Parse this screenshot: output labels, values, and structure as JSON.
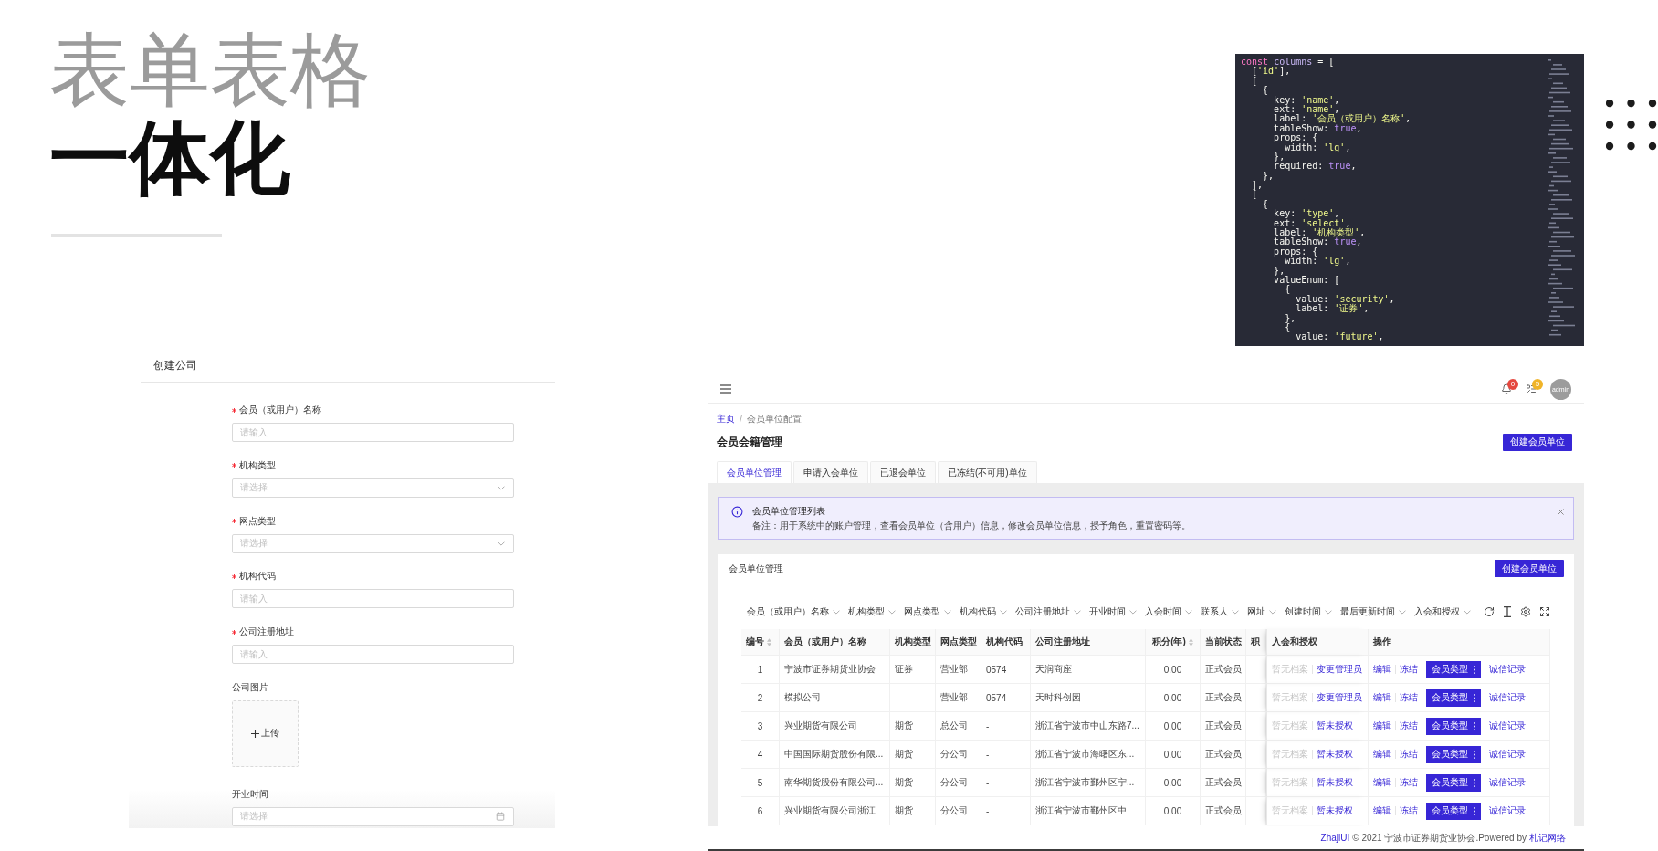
{
  "slide": {
    "headline": "表单表格",
    "headline_bold": "一体化"
  },
  "code_editor": {
    "lines": [
      [
        {
          "kind": "keyword",
          "text": "const"
        },
        {
          "kind": "name",
          "text": " columns"
        },
        {
          "kind": "plain",
          "text": " = ["
        }
      ],
      [
        {
          "kind": "plain",
          "text": "  ["
        },
        {
          "kind": "string",
          "text": "'id'"
        },
        {
          "kind": "plain",
          "text": "],"
        }
      ],
      [
        {
          "kind": "plain",
          "text": "  ["
        }
      ],
      [
        {
          "kind": "plain",
          "text": "    {"
        }
      ],
      [
        {
          "kind": "plain",
          "text": "      key: "
        },
        {
          "kind": "string",
          "text": "'name'"
        },
        {
          "kind": "plain",
          "text": ","
        }
      ],
      [
        {
          "kind": "plain",
          "text": "      ext: "
        },
        {
          "kind": "string",
          "text": "'name'"
        },
        {
          "kind": "plain",
          "text": ","
        }
      ],
      [
        {
          "kind": "plain",
          "text": "      label: "
        },
        {
          "kind": "string",
          "text": "'会员（或用户）名称'"
        },
        {
          "kind": "plain",
          "text": ","
        }
      ],
      [
        {
          "kind": "plain",
          "text": "      tableShow: "
        },
        {
          "kind": "literal",
          "text": "true"
        },
        {
          "kind": "plain",
          "text": ","
        }
      ],
      [
        {
          "kind": "plain",
          "text": "      props: {"
        }
      ],
      [
        {
          "kind": "plain",
          "text": "        width: "
        },
        {
          "kind": "string",
          "text": "'lg'"
        },
        {
          "kind": "plain",
          "text": ","
        }
      ],
      [
        {
          "kind": "plain",
          "text": "      },"
        }
      ],
      [
        {
          "kind": "plain",
          "text": "      required: "
        },
        {
          "kind": "literal",
          "text": "true"
        },
        {
          "kind": "plain",
          "text": ","
        }
      ],
      [
        {
          "kind": "plain",
          "text": "    },"
        }
      ],
      [
        {
          "kind": "plain",
          "text": "  ],"
        }
      ],
      [
        {
          "kind": "plain",
          "text": "  ["
        }
      ],
      [
        {
          "kind": "plain",
          "text": "    {"
        }
      ],
      [
        {
          "kind": "plain",
          "text": "      key: "
        },
        {
          "kind": "string",
          "text": "'type'"
        },
        {
          "kind": "plain",
          "text": ","
        }
      ],
      [
        {
          "kind": "plain",
          "text": "      ext: "
        },
        {
          "kind": "string",
          "text": "'select'"
        },
        {
          "kind": "plain",
          "text": ","
        }
      ],
      [
        {
          "kind": "plain",
          "text": "      label: "
        },
        {
          "kind": "string",
          "text": "'机构类型'"
        },
        {
          "kind": "plain",
          "text": ","
        }
      ],
      [
        {
          "kind": "plain",
          "text": "      tableShow: "
        },
        {
          "kind": "literal",
          "text": "true"
        },
        {
          "kind": "plain",
          "text": ","
        }
      ],
      [
        {
          "kind": "plain",
          "text": "      props: {"
        }
      ],
      [
        {
          "kind": "plain",
          "text": "        width: "
        },
        {
          "kind": "string",
          "text": "'lg'"
        },
        {
          "kind": "plain",
          "text": ","
        }
      ],
      [
        {
          "kind": "plain",
          "text": "      },"
        }
      ],
      [
        {
          "kind": "plain",
          "text": "      valueEnum: ["
        }
      ],
      [
        {
          "kind": "plain",
          "text": "        {"
        }
      ],
      [
        {
          "kind": "plain",
          "text": "          value: "
        },
        {
          "kind": "string",
          "text": "'security'"
        },
        {
          "kind": "plain",
          "text": ","
        }
      ],
      [
        {
          "kind": "plain",
          "text": "          label: "
        },
        {
          "kind": "string",
          "text": "'证券'"
        },
        {
          "kind": "plain",
          "text": ","
        }
      ],
      [
        {
          "kind": "plain",
          "text": "        },"
        }
      ],
      [
        {
          "kind": "plain",
          "text": "        {"
        }
      ],
      [
        {
          "kind": "plain",
          "text": "          value: "
        },
        {
          "kind": "string",
          "text": "'future'"
        },
        {
          "kind": "plain",
          "text": ","
        }
      ]
    ]
  },
  "form_panel": {
    "title": "创建公司",
    "fields": [
      {
        "kind": "input",
        "label": "会员（或用户）名称",
        "required": true,
        "placeholder": "请输入"
      },
      {
        "kind": "select",
        "label": "机构类型",
        "required": true,
        "placeholder": "请选择"
      },
      {
        "kind": "select",
        "label": "网点类型",
        "required": true,
        "placeholder": "请选择"
      },
      {
        "kind": "input",
        "label": "机构代码",
        "required": true,
        "placeholder": "请输入"
      },
      {
        "kind": "input",
        "label": "公司注册地址",
        "required": true,
        "placeholder": "请输入"
      },
      {
        "kind": "upload",
        "label": "公司图片",
        "required": false,
        "button_text": "上传"
      },
      {
        "kind": "date",
        "label": "开业时间",
        "required": false,
        "placeholder": "请选择"
      }
    ]
  },
  "app": {
    "top_bar": {
      "badges": [
        {
          "kind": "bell",
          "count": "0",
          "color": "#e5483f"
        },
        {
          "kind": "list",
          "count": "5",
          "color": "#f0b429"
        }
      ],
      "avatar": "admin"
    },
    "breadcrumb": {
      "items": [
        {
          "label": "主页",
          "current": false
        },
        {
          "label": "会员单位配置",
          "current": true
        }
      ],
      "separator": "/"
    },
    "page_title": "会员会籍管理",
    "page_button": "创建会员单位",
    "tabs": [
      {
        "label": "会员单位管理",
        "selected": true
      },
      {
        "label": "申请入会单位",
        "selected": false
      },
      {
        "label": "已退会单位",
        "selected": false
      },
      {
        "label": "已冻结(不可用)单位",
        "selected": false
      }
    ],
    "alert": {
      "title": "会员单位管理列表",
      "description": "备注：用于系统中的账户管理，查看会员单位（含用户）信息，修改会员单位信息，授予角色，重置密码等。"
    },
    "card": {
      "title": "会员单位管理",
      "button": "创建会员单位",
      "column_filters": [
        "会员（或用户）名称",
        "机构类型",
        "网点类型",
        "机构代码",
        "公司注册地址",
        "开业时间",
        "入会时间",
        "联系人",
        "网址",
        "创建时间",
        "最后更新时间",
        "入会和授权"
      ],
      "table": {
        "columns": [
          {
            "label": "编号",
            "kind": "index",
            "sortable": true
          },
          {
            "label": "会员（或用户）名称",
            "kind": "text",
            "sortable": false
          },
          {
            "label": "机构类型",
            "kind": "text",
            "sortable": false
          },
          {
            "label": "网点类型",
            "kind": "text",
            "sortable": false
          },
          {
            "label": "机构代码",
            "kind": "text",
            "sortable": false
          },
          {
            "label": "公司注册地址",
            "kind": "text",
            "sortable": false
          },
          {
            "label": "积分(年)",
            "kind": "number",
            "sortable": true
          },
          {
            "label": "当前状态",
            "kind": "text",
            "sortable": false
          },
          {
            "label": "积",
            "kind": "clipped",
            "sortable": false
          },
          {
            "label": "入会和授权",
            "kind": "membership",
            "sortable": false
          },
          {
            "label": "操作",
            "kind": "actions",
            "sortable": false
          }
        ],
        "rows": [
          {
            "cells": [
              "1",
              "宁波市证券期货业协会",
              "证券",
              "营业部",
              "0574",
              "天润商座",
              "0.00",
              "正式会员"
            ],
            "membership": [
              {
                "label": "暂无档案",
                "disabled": true
              },
              {
                "label": "变更管理员",
                "disabled": false
              }
            ],
            "actions": [
              {
                "kind": "link",
                "label": "编辑"
              },
              {
                "kind": "link",
                "label": "冻结"
              },
              {
                "kind": "menu_button",
                "label": "会员类型"
              },
              {
                "kind": "link",
                "label": "诚信记录"
              }
            ]
          },
          {
            "cells": [
              "2",
              "模拟公司",
              "-",
              "营业部",
              "0574",
              "天时科创园",
              "0.00",
              "正式会员"
            ],
            "membership": [
              {
                "label": "暂无档案",
                "disabled": true
              },
              {
                "label": "变更管理员",
                "disabled": false
              }
            ],
            "actions": [
              {
                "kind": "link",
                "label": "编辑"
              },
              {
                "kind": "link",
                "label": "冻结"
              },
              {
                "kind": "menu_button",
                "label": "会员类型"
              },
              {
                "kind": "link",
                "label": "诚信记录"
              }
            ]
          },
          {
            "cells": [
              "3",
              "兴业期货有限公司",
              "期货",
              "总公司",
              "-",
              "浙江省宁波市中山东路7...",
              "0.00",
              "正式会员"
            ],
            "membership": [
              {
                "label": "暂无档案",
                "disabled": true
              },
              {
                "label": "暂未授权",
                "disabled": false
              }
            ],
            "actions": [
              {
                "kind": "link",
                "label": "编辑"
              },
              {
                "kind": "link",
                "label": "冻结"
              },
              {
                "kind": "menu_button",
                "label": "会员类型"
              },
              {
                "kind": "link",
                "label": "诚信记录"
              }
            ]
          },
          {
            "cells": [
              "4",
              "中国国际期货股份有限...",
              "期货",
              "分公司",
              "-",
              "浙江省宁波市海曙区东...",
              "0.00",
              "正式会员"
            ],
            "membership": [
              {
                "label": "暂无档案",
                "disabled": true
              },
              {
                "label": "暂未授权",
                "disabled": false
              }
            ],
            "actions": [
              {
                "kind": "link",
                "label": "编辑"
              },
              {
                "kind": "link",
                "label": "冻结"
              },
              {
                "kind": "menu_button",
                "label": "会员类型"
              },
              {
                "kind": "link",
                "label": "诚信记录"
              }
            ]
          },
          {
            "cells": [
              "5",
              "南华期货股份有限公司...",
              "期货",
              "分公司",
              "-",
              "浙江省宁波市鄞州区宁...",
              "0.00",
              "正式会员"
            ],
            "membership": [
              {
                "label": "暂无档案",
                "disabled": true
              },
              {
                "label": "暂未授权",
                "disabled": false
              }
            ],
            "actions": [
              {
                "kind": "link",
                "label": "编辑"
              },
              {
                "kind": "link",
                "label": "冻结"
              },
              {
                "kind": "menu_button",
                "label": "会员类型"
              },
              {
                "kind": "link",
                "label": "诚信记录"
              }
            ]
          },
          {
            "cells": [
              "6",
              "兴业期货有限公司浙江",
              "期货",
              "分公司",
              "-",
              "浙江省宁波市鄞州区中",
              "0.00",
              "正式会员"
            ],
            "membership": [
              {
                "label": "暂无档案",
                "disabled": true
              },
              {
                "label": "暂未授权",
                "disabled": false
              }
            ],
            "actions": [
              {
                "kind": "link",
                "label": "编辑"
              },
              {
                "kind": "link",
                "label": "冻结"
              },
              {
                "kind": "menu_button",
                "label": "会员类型"
              },
              {
                "kind": "link",
                "label": "诚信记录"
              }
            ]
          }
        ]
      }
    },
    "footer": {
      "brand": "ZhajiUI",
      "text": "© 2021 宁波市证券期货业协会.Powered by",
      "company": "札记网络"
    }
  }
}
